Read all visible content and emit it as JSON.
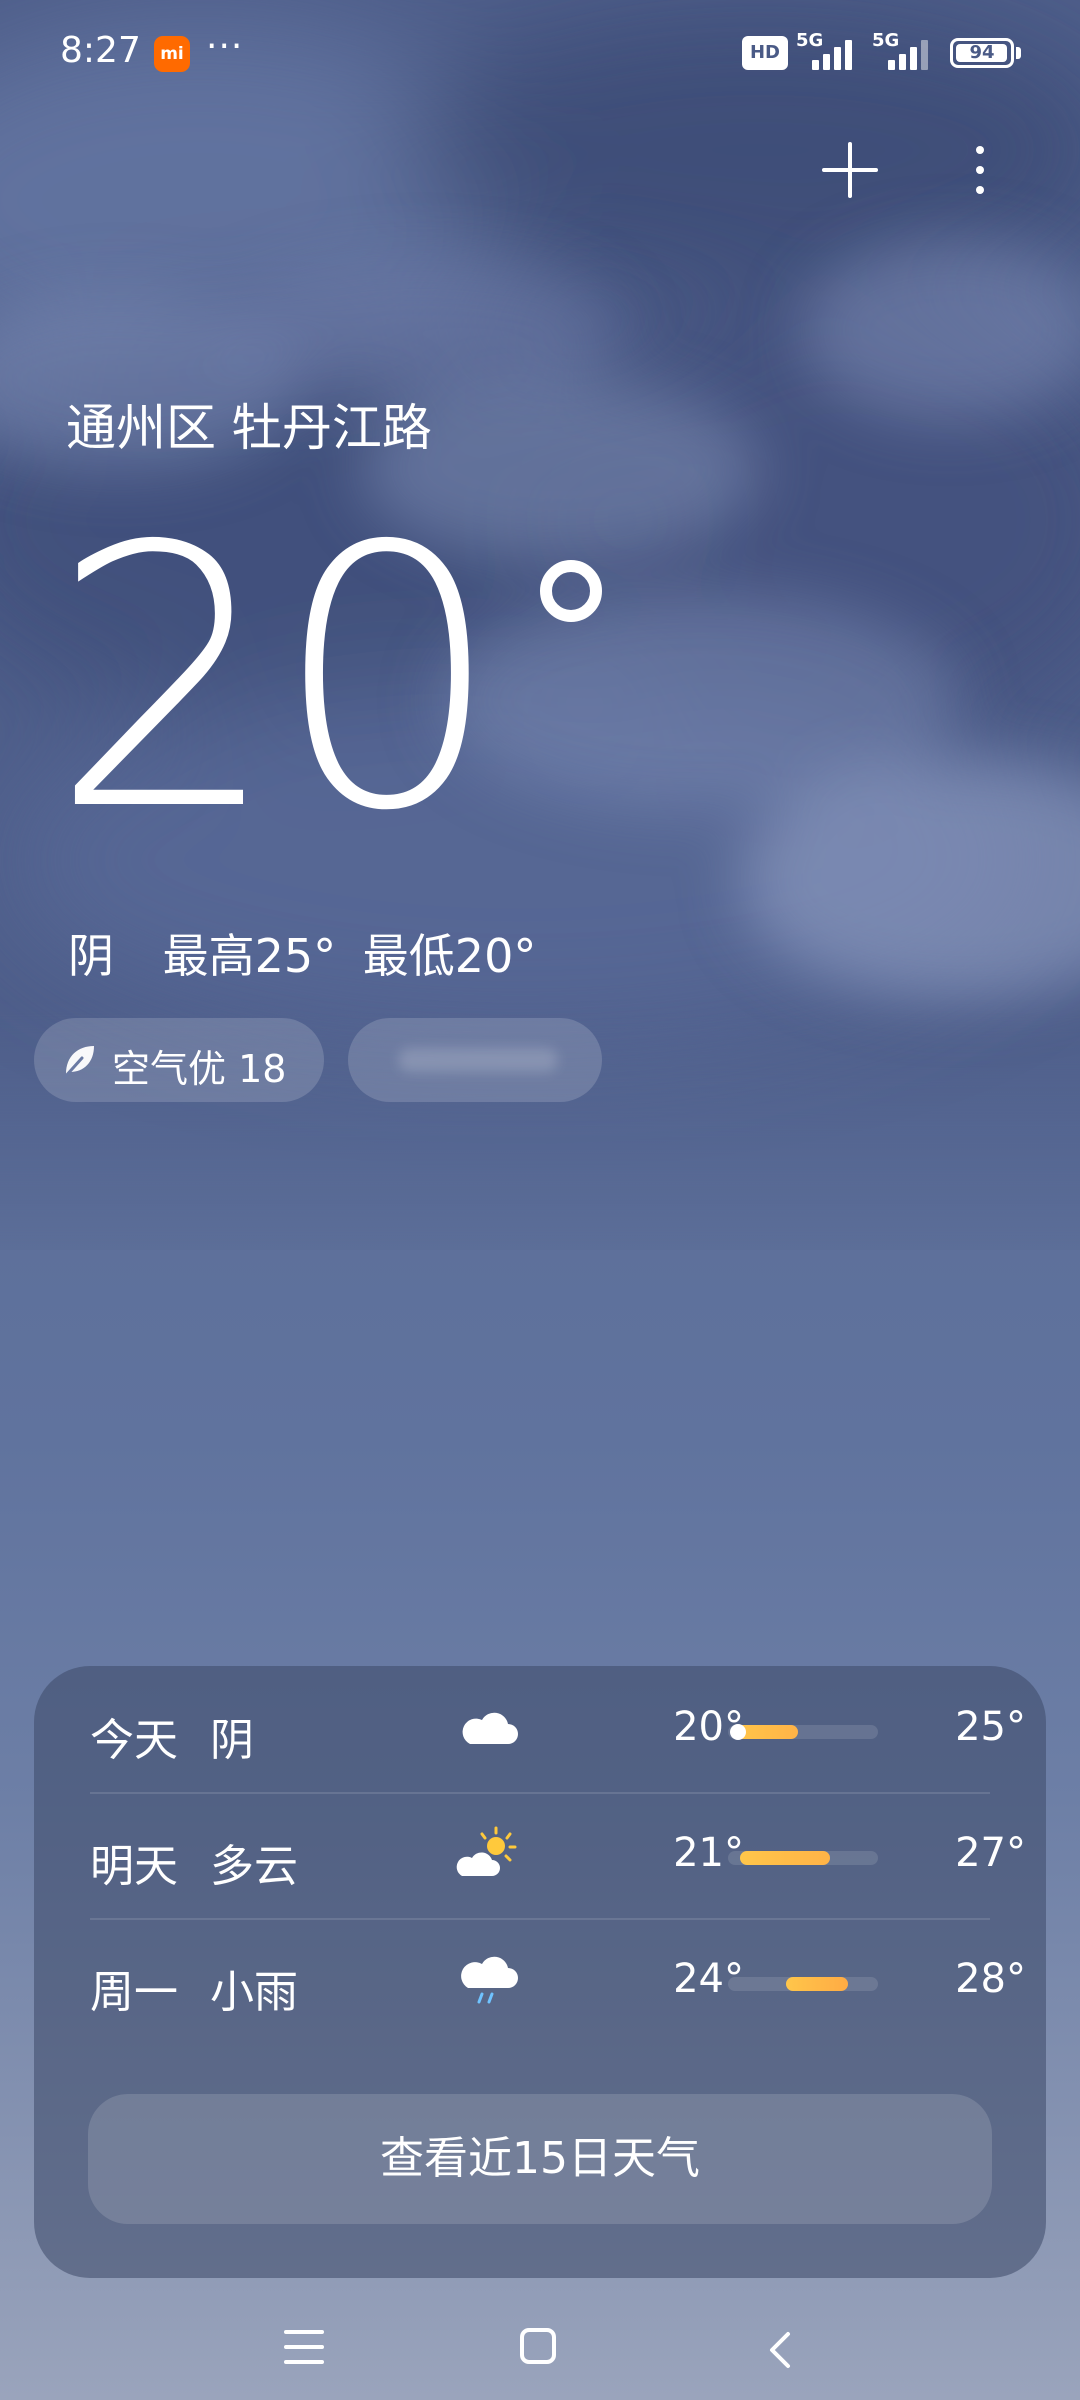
{
  "status_bar": {
    "time": "8:27",
    "app_badge": "mi",
    "more": "···",
    "hd_badge": "HD",
    "network_1": "5G",
    "network_2": "5G",
    "battery": "94"
  },
  "header": {
    "add_icon": "plus-icon",
    "more_icon": "more-vertical-icon"
  },
  "current": {
    "location": "通州区 牡丹江路",
    "temperature": "20",
    "condition": "阴",
    "high": "最高25°",
    "low": "最低20°",
    "air_quality": "空气优 18"
  },
  "forecast": [
    {
      "day": "今天",
      "condition": "阴",
      "icon": "cloudy-icon",
      "low": "20°",
      "high": "25°",
      "range_start": 0.05,
      "range_end": 0.5,
      "now": 0.05
    },
    {
      "day": "明天",
      "condition": "多云",
      "icon": "partly-cloudy-icon",
      "low": "21°",
      "high": "27°",
      "range_start": 0.1,
      "range_end": 0.72,
      "now": null
    },
    {
      "day": "周一",
      "condition": "小雨",
      "icon": "light-rain-icon",
      "low": "24°",
      "high": "28°",
      "range_start": 0.4,
      "range_end": 0.8,
      "now": null
    }
  ],
  "forecast_button": "查看近15日天气",
  "colors": {
    "range_bar": "#ffc64a",
    "sun": "#ffc93c",
    "rain": "#6fc3ff",
    "mi_badge": "#ff6a00"
  },
  "nav": {
    "menu_icon": "menu-icon",
    "home_icon": "home-icon",
    "back_icon": "back-icon"
  }
}
